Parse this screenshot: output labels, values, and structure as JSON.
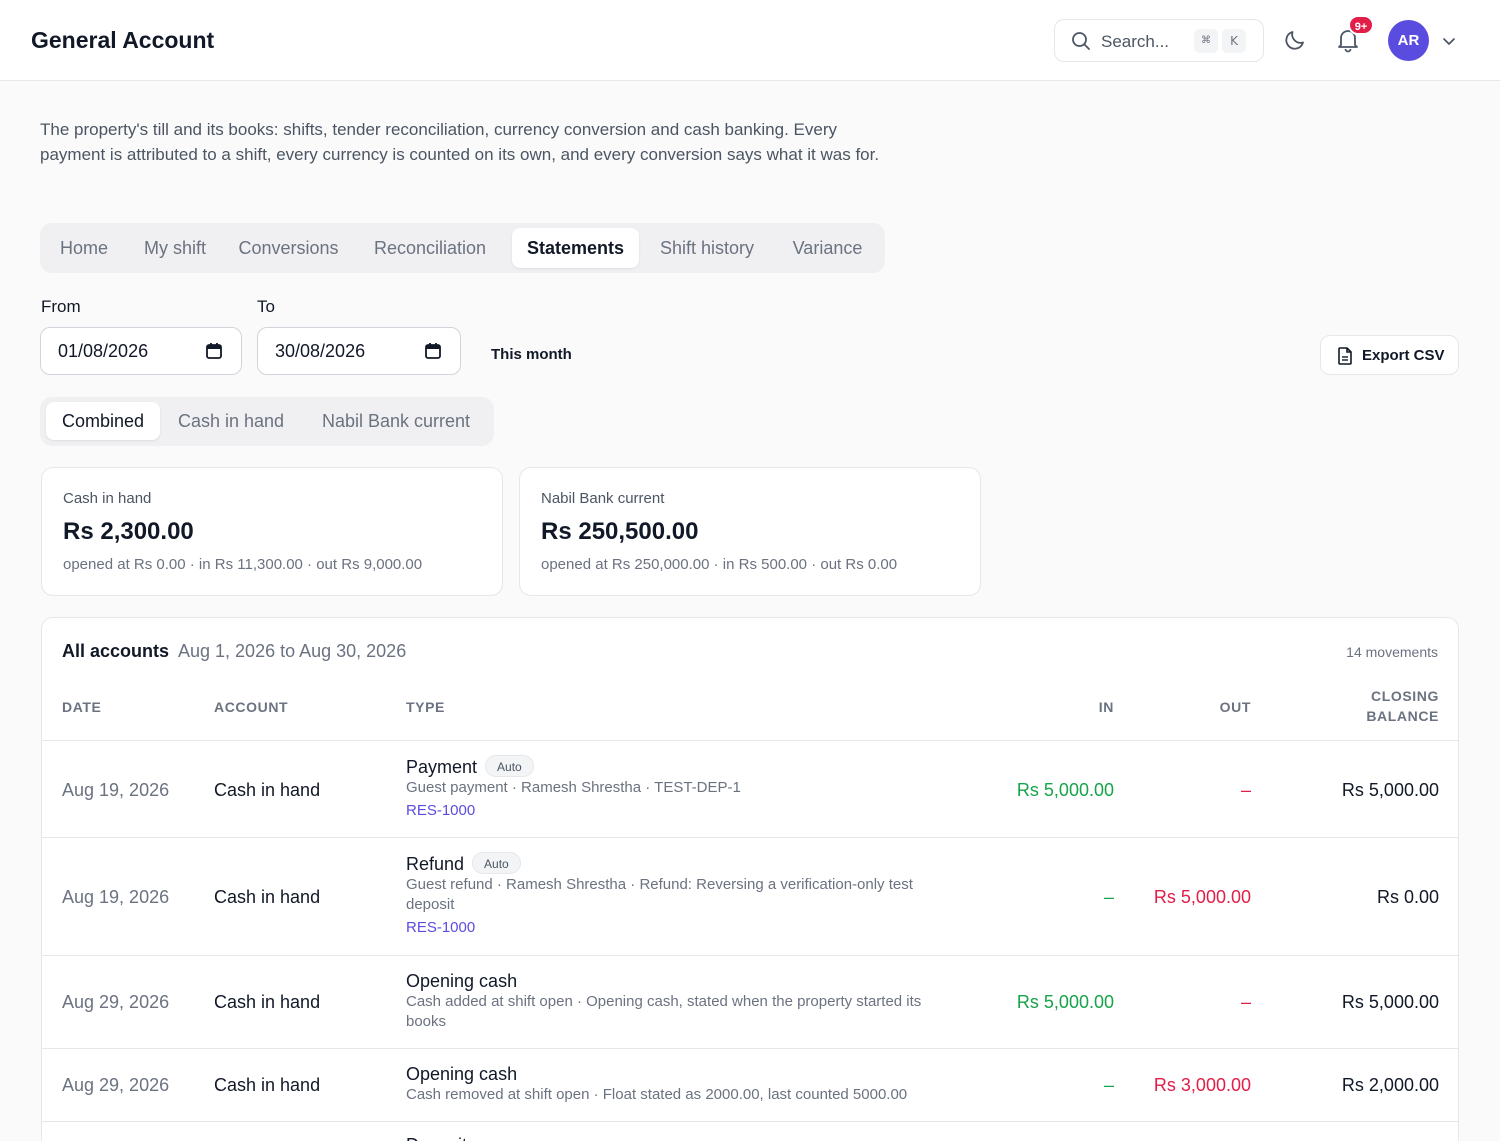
{
  "header": {
    "title": "General Account",
    "search_placeholder": "Search...",
    "kbd_mod": "⌘",
    "kbd_key": "K",
    "notification_badge": "9+",
    "avatar_initials": "AR"
  },
  "description": "The property's till and its books: shifts, tender reconciliation, currency conversion and cash banking. Every payment is attributed to a shift, every currency is counted on its own, and every conversion says what it was for.",
  "tabs": [
    "Home",
    "My shift",
    "Conversions",
    "Reconciliation",
    "Statements",
    "Shift history",
    "Variance"
  ],
  "active_tab": "Statements",
  "filters": {
    "from_label": "From",
    "from_value": "01/08/2026",
    "to_label": "To",
    "to_value": "30/08/2026",
    "preset": "This month",
    "export_label": "Export CSV"
  },
  "account_tabs": [
    "Combined",
    "Cash in hand",
    "Nabil Bank current"
  ],
  "active_account_tab": "Combined",
  "cards": [
    {
      "name": "Cash in hand",
      "balance": "Rs 2,300.00",
      "detail": "opened at Rs 0.00 · in Rs 11,300.00 · out Rs 9,000.00"
    },
    {
      "name": "Nabil Bank current",
      "balance": "Rs 250,500.00",
      "detail": "opened at Rs 250,000.00 · in Rs 500.00 · out Rs 0.00"
    }
  ],
  "ledger": {
    "title": "All accounts",
    "range": "Aug 1, 2026 to Aug 30, 2026",
    "count": "14 movements",
    "columns": {
      "date": "DATE",
      "account": "ACCOUNT",
      "type": "TYPE",
      "in": "IN",
      "out": "OUT",
      "closing_1": "CLOSING",
      "closing_2": "BALANCE"
    },
    "rows": [
      {
        "date": "Aug 19, 2026",
        "account": "Cash in hand",
        "type": "Payment",
        "auto": "Auto",
        "sub": "Guest payment · Ramesh Shrestha · TEST-DEP-1",
        "ref": "RES-1000",
        "in": "Rs 5,000.00",
        "out": "–",
        "balance": "Rs 5,000.00"
      },
      {
        "date": "Aug 19, 2026",
        "account": "Cash in hand",
        "type": "Refund",
        "auto": "Auto",
        "sub": "Guest refund · Ramesh Shrestha · Refund: Reversing a verification-only test deposit",
        "ref": "RES-1000",
        "in": "–",
        "out": "Rs 5,000.00",
        "balance": "Rs 0.00"
      },
      {
        "date": "Aug 29, 2026",
        "account": "Cash in hand",
        "type": "Opening cash",
        "sub": "Cash added at shift open · Opening cash, stated when the property started its books",
        "in": "Rs 5,000.00",
        "out": "–",
        "balance": "Rs 5,000.00"
      },
      {
        "date": "Aug 29, 2026",
        "account": "Cash in hand",
        "type": "Opening cash",
        "sub": "Cash removed at shift open · Float stated as 2000.00, last counted 5000.00",
        "in": "–",
        "out": "Rs 3,000.00",
        "balance": "Rs 2,000.00"
      },
      {
        "date": "",
        "account": "",
        "type": "Deposit",
        "sub": "",
        "in": "",
        "out": "",
        "balance": ""
      }
    ]
  },
  "colors": {
    "accent": "#5b4ce0",
    "in": "#16a34a",
    "out": "#e11d48",
    "badge": "#e11d48"
  }
}
